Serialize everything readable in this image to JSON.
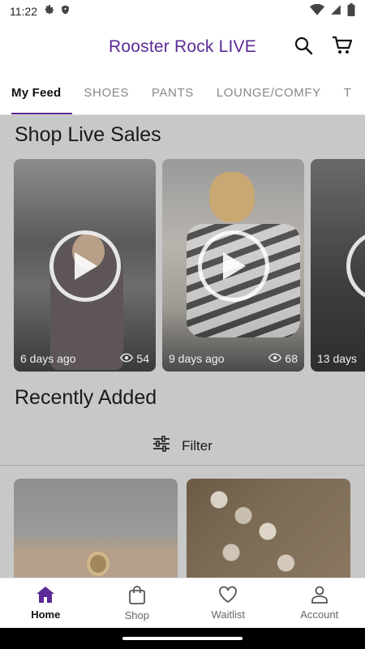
{
  "status_bar": {
    "time": "11:22"
  },
  "app": {
    "title": "Rooster Rock LIVE"
  },
  "tabs": [
    {
      "label": "My Feed"
    },
    {
      "label": "SHOES"
    },
    {
      "label": "PANTS"
    },
    {
      "label": "LOUNGE/COMFY"
    },
    {
      "label": "T"
    }
  ],
  "live_sales": {
    "title": "Shop Live Sales",
    "cards": [
      {
        "age": "6 days ago",
        "views": "54"
      },
      {
        "age": "9 days ago",
        "views": "68"
      },
      {
        "age": "13 days"
      }
    ]
  },
  "recently_added": {
    "title": "Recently Added",
    "filter_label": "Filter"
  },
  "bottom_nav": [
    {
      "label": "Home"
    },
    {
      "label": "Shop"
    },
    {
      "label": "Waitlist"
    },
    {
      "label": "Account"
    }
  ],
  "colors": {
    "brand": "#5b2a96",
    "overlay": "#c8c8c8"
  }
}
